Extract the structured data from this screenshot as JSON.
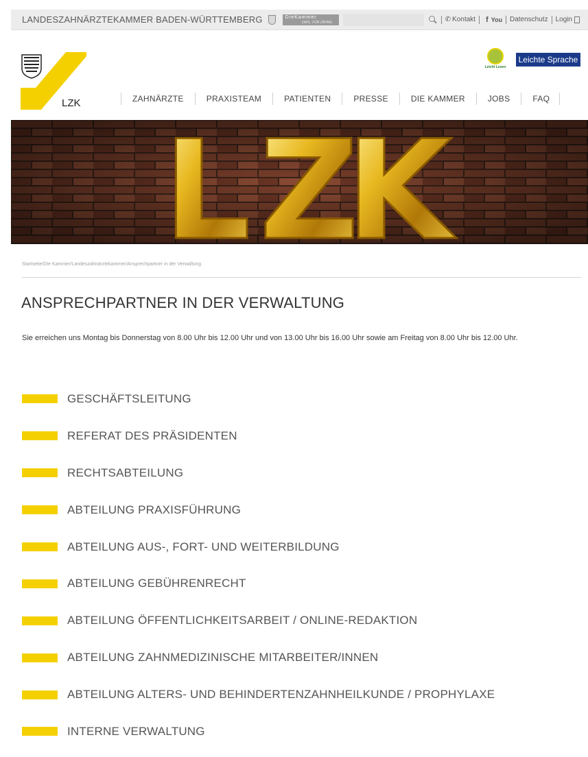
{
  "topbar": {
    "org_name": "LANDESZAHNÄRZTEKAMMER BADEN-WÜRTTEMBERG",
    "badge_top": "DieKammer",
    "badge_bottom": "ZAHL. FÜR ZÄHNE.",
    "search_placeholder": "",
    "links": {
      "kontakt": "Kontakt",
      "facebook": "f",
      "youtube": "You",
      "datenschutz": "Datenschutz",
      "login": "Login"
    }
  },
  "header": {
    "logo_text": "LZK",
    "easy_read_label": "Leicht Lesen",
    "leichte_sprache": "Leichte Sprache",
    "nav": [
      "ZAHNÄRZTE",
      "PRAXISTEAM",
      "PATIENTEN",
      "PRESSE",
      "DIE KAMMER",
      "JOBS",
      "FAQ"
    ]
  },
  "hero": {
    "letters": [
      "L",
      "Z",
      "K"
    ]
  },
  "breadcrumb": "Startseite/Die Kammer/Landeszahnärztekammer/Ansprechpartner in der Verwaltung",
  "main": {
    "title": "ANSPRECHPARTNER IN DER VERWALTUNG",
    "intro": "Sie erreichen uns Montag bis Donnerstag von 8.00 Uhr bis 12.00 Uhr und von 13.00 Uhr bis 16.00 Uhr sowie am Freitag von 8.00 Uhr bis 12.00 Uhr.",
    "departments": [
      "GESCHÄFTSLEITUNG",
      "REFERAT DES PRÄSIDENTEN",
      "RECHTSABTEILUNG",
      "ABTEILUNG PRAXISFÜHRUNG",
      "ABTEILUNG AUS-, FORT- UND WEITERBILDUNG",
      "ABTEILUNG GEBÜHRENRECHT",
      "ABTEILUNG ÖFFENTLICHKEITSARBEIT / ONLINE-REDAKTION",
      "ABTEILUNG ZAHNMEDIZINISCHE MITARBEITER/INNEN",
      "ABTEILUNG ALTERS- UND BEHINDERTENZAHNHEILKUNDE / PROPHYLAXE",
      "INTERNE VERWALTUNG"
    ]
  },
  "colors": {
    "accent_yellow": "#f5d000",
    "button_blue": "#1b3a8a",
    "topbar_gray": "#ececec"
  }
}
